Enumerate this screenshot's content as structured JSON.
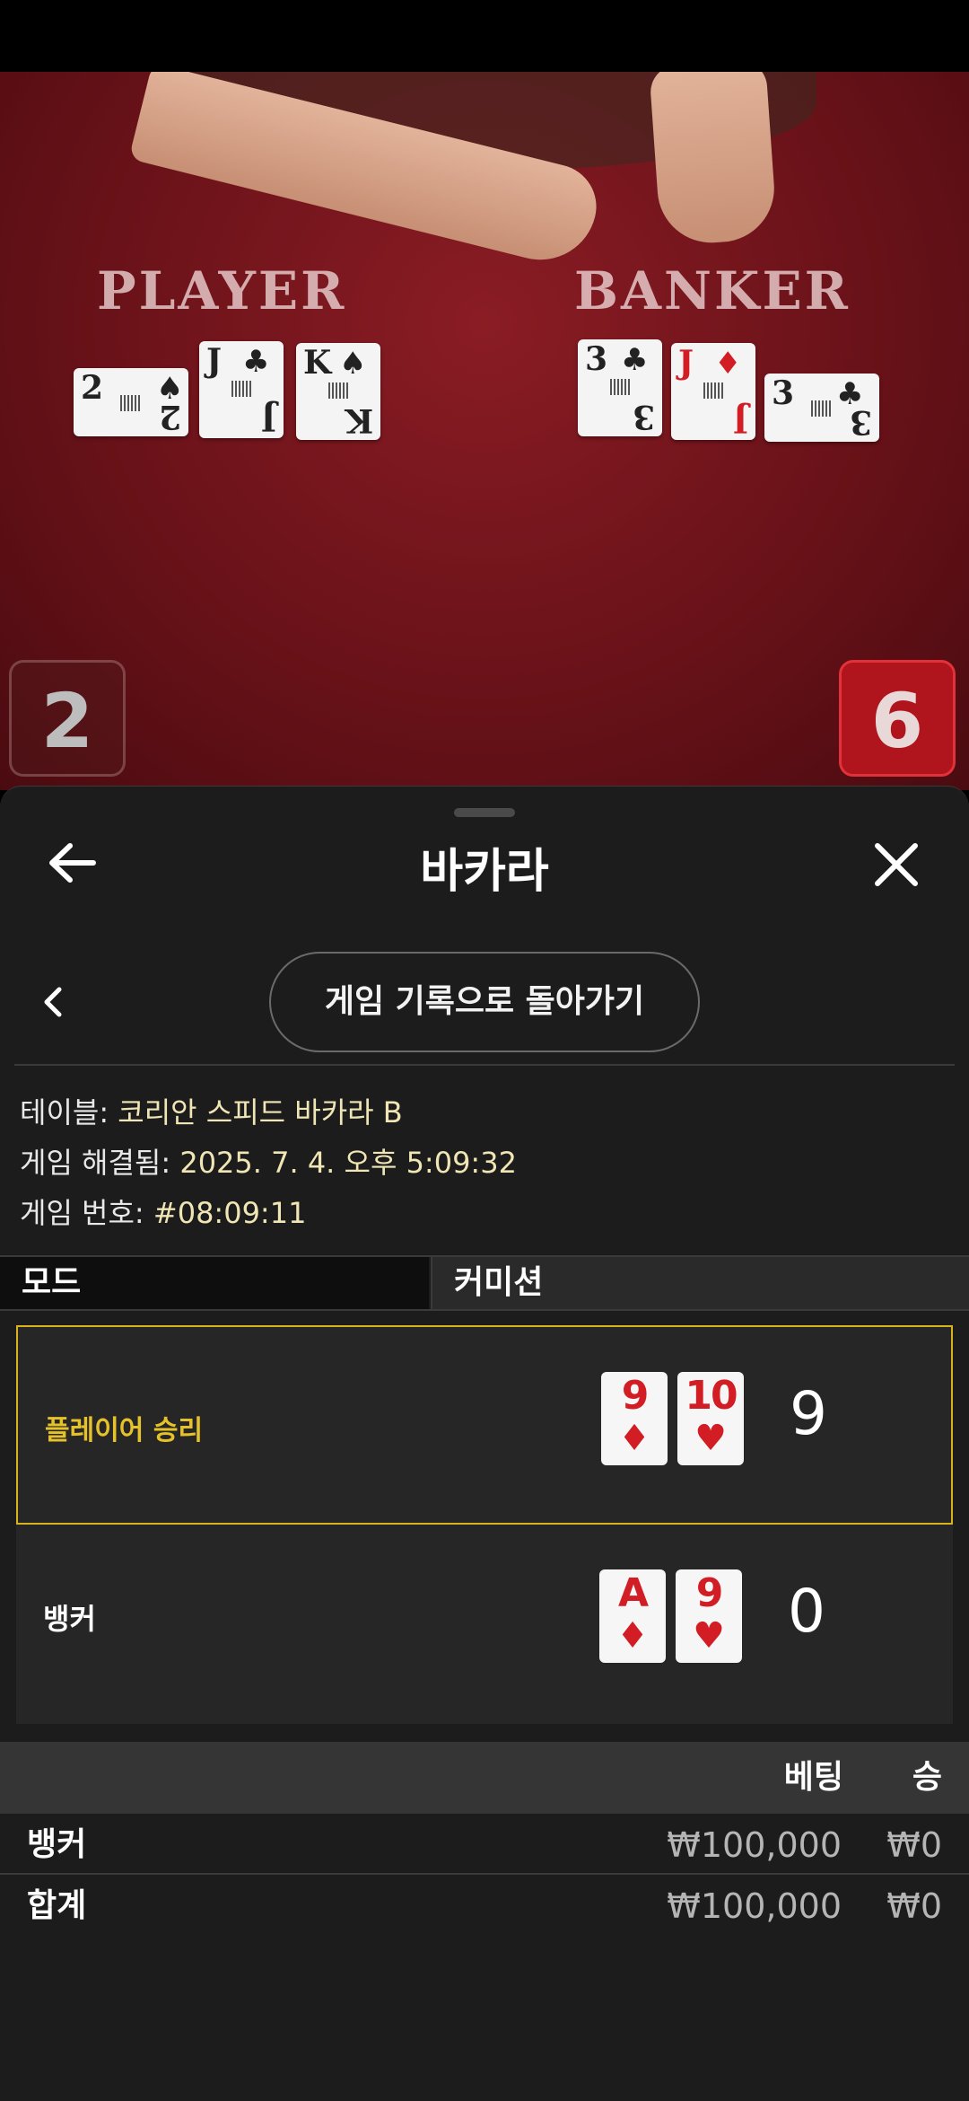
{
  "video": {
    "player_label": "PLAYER",
    "banker_label": "BANKER",
    "player_cards": [
      {
        "rank": "2",
        "suit": "♠",
        "color": "black"
      },
      {
        "rank": "J",
        "suit": "♣",
        "color": "black"
      },
      {
        "rank": "K",
        "suit": "♠",
        "color": "black"
      }
    ],
    "banker_cards": [
      {
        "rank": "3",
        "suit": "♣",
        "color": "black"
      },
      {
        "rank": "J",
        "suit": "♦",
        "color": "red"
      },
      {
        "rank": "3",
        "suit": "♣",
        "color": "black"
      }
    ],
    "player_score": "2",
    "banker_score": "6"
  },
  "header": {
    "title": "바카라"
  },
  "history_button_label": "게임 기록으로 돌아가기",
  "info": {
    "table_label": "테이블: ",
    "table_value": "코리안 스피드 바카라 B",
    "resolved_label": "게임 해결됨: ",
    "resolved_value": "2025. 7. 4. 오후 5:09:32",
    "number_label": "게임 번호: ",
    "number_value": "#08:09:11"
  },
  "mode_row": {
    "mode": "모드",
    "commission": "커미션"
  },
  "outcomes": [
    {
      "label": "플레이어 승리",
      "cards": [
        {
          "rank": "9",
          "suit": "♦"
        },
        {
          "rank": "10",
          "suit": "♥"
        }
      ],
      "points": "9"
    },
    {
      "label": "뱅커",
      "cards": [
        {
          "rank": "A",
          "suit": "♦"
        },
        {
          "rank": "9",
          "suit": "♥"
        }
      ],
      "points": "0"
    }
  ],
  "bets": {
    "col_bet": "베팅",
    "col_win": "승",
    "rows": [
      {
        "name": "뱅커",
        "bet": "₩100,000",
        "win": "₩0"
      },
      {
        "name": "합계",
        "bet": "₩100,000",
        "win": "₩0"
      }
    ]
  },
  "colors": {
    "accent_gold": "#d9b21e",
    "felt_red": "#7a1620",
    "banker_badge": "#b0141c",
    "card_red": "#d21d24"
  }
}
